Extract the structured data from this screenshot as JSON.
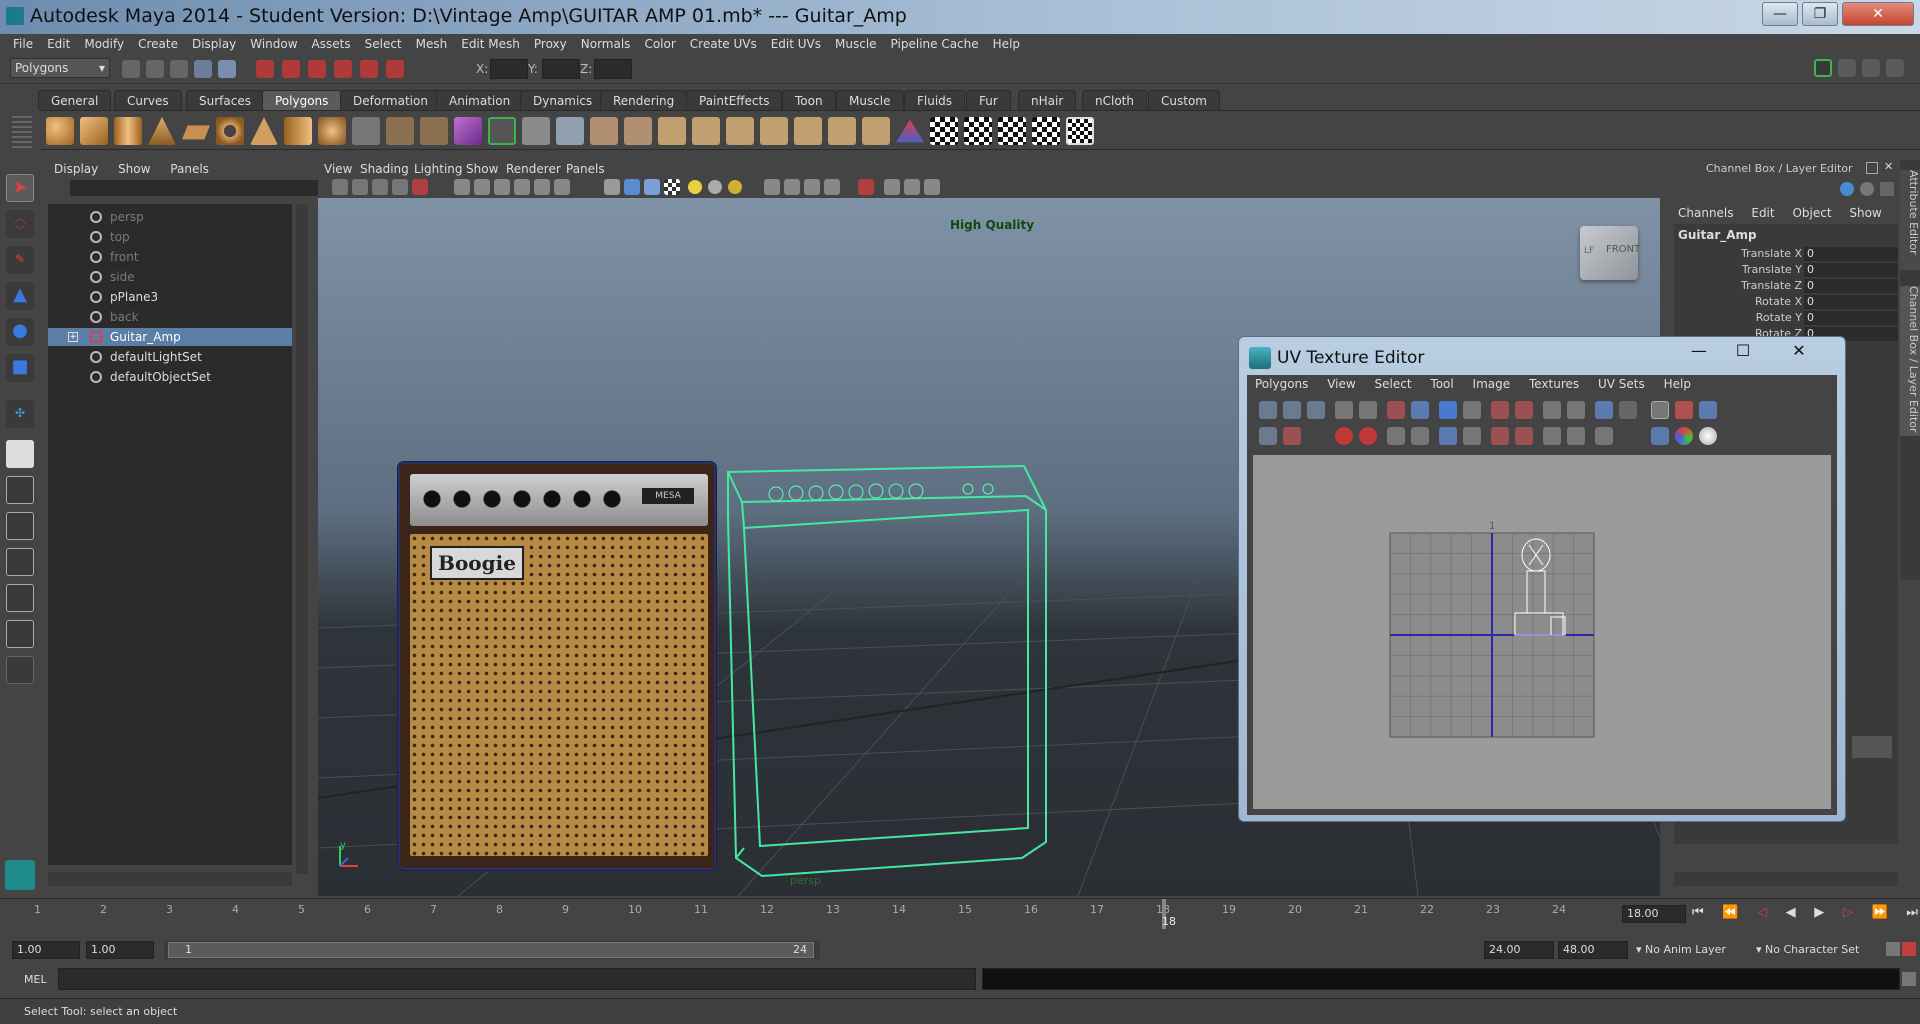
{
  "window": {
    "title": "Autodesk Maya 2014 - Student Version: D:\\Vintage Amp\\GUITAR AMP 01.mb*   ---   Guitar_Amp",
    "min_glyph": "—",
    "max_glyph": "❐",
    "close_glyph": "✕"
  },
  "menubar": [
    "File",
    "Edit",
    "Modify",
    "Create",
    "Display",
    "Window",
    "Assets",
    "Select",
    "Mesh",
    "Edit Mesh",
    "Proxy",
    "Normals",
    "Color",
    "Create UVs",
    "Edit UVs",
    "Muscle",
    "Pipeline Cache",
    "Help"
  ],
  "statusline": {
    "mode": "Polygons",
    "x_label": "X:",
    "y_label": "Y:",
    "z_label": "Z:"
  },
  "shelf_tabs": [
    "General",
    "Curves",
    "Surfaces",
    "Polygons",
    "Deformation",
    "Animation",
    "Dynamics",
    "Rendering",
    "PaintEffects",
    "Toon",
    "Muscle",
    "Fluids",
    "Fur",
    "nHair",
    "nCloth",
    "Custom"
  ],
  "shelf_active": "Polygons",
  "outliner": {
    "menu": [
      "Display",
      "Show",
      "Panels"
    ],
    "items": [
      {
        "label": "persp",
        "dim": true
      },
      {
        "label": "top",
        "dim": true
      },
      {
        "label": "front",
        "dim": true
      },
      {
        "label": "side",
        "dim": true
      },
      {
        "label": "pPlane3",
        "dim": false
      },
      {
        "label": "back",
        "dim": true
      },
      {
        "label": "Guitar_Amp",
        "dim": false,
        "selected": true
      },
      {
        "label": "defaultLightSet",
        "dim": false
      },
      {
        "label": "defaultObjectSet",
        "dim": false
      }
    ]
  },
  "viewport": {
    "menu": [
      "View",
      "Shading",
      "Lighting",
      "Show",
      "Renderer",
      "Panels"
    ],
    "hud_quality": "High Quality",
    "camera_label": "persp",
    "viewcube_label": "FRONT",
    "viewcube_side": "LF",
    "amp_logo": "Boogie",
    "amp_brand": "MESA",
    "axis_y": "y"
  },
  "channel_box": {
    "title": "Channel Box / Layer Editor",
    "menu": [
      "Channels",
      "Edit",
      "Object",
      "Show"
    ],
    "object": "Guitar_Amp",
    "channels": [
      {
        "name": "Translate X",
        "value": "0"
      },
      {
        "name": "Translate Y",
        "value": "0"
      },
      {
        "name": "Translate Z",
        "value": "0"
      },
      {
        "name": "Rotate X",
        "value": "0"
      },
      {
        "name": "Rotate Y",
        "value": "0"
      },
      {
        "name": "Rotate Z",
        "value": "0"
      }
    ],
    "side_tab_1": "Attribute Editor",
    "side_tab_2": "Channel Box / Layer Editor"
  },
  "uv_editor": {
    "title": "UV Texture Editor",
    "menu": [
      "Polygons",
      "View",
      "Select",
      "Tool",
      "Image",
      "Textures",
      "UV Sets",
      "Help"
    ],
    "grid_top_label": "1"
  },
  "timeline": {
    "ticks": [
      "1",
      "2",
      "3",
      "4",
      "5",
      "6",
      "7",
      "8",
      "9",
      "10",
      "11",
      "12",
      "13",
      "14",
      "15",
      "16",
      "17",
      "18",
      "19",
      "20",
      "21",
      "22",
      "23",
      "24"
    ],
    "current_frame_label": "18",
    "current_time": "18.00"
  },
  "range": {
    "start_outer": "1.00",
    "start_inner": "1.00",
    "slider_start": "1",
    "slider_end": "24",
    "end_inner": "24.00",
    "end_outer": "48.00",
    "anim_layer": "No Anim Layer",
    "char_set": "No Character Set"
  },
  "mel": {
    "label": "MEL"
  },
  "help_line": "Select Tool: select an object"
}
